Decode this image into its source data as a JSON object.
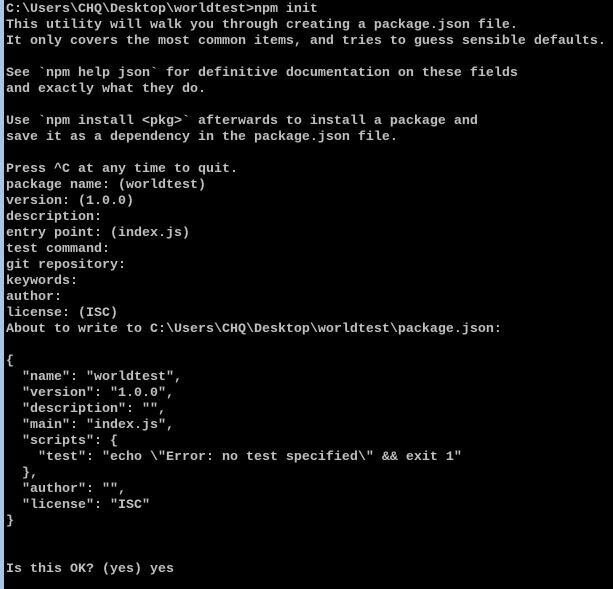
{
  "console": {
    "lines": [
      "C:\\Users\\CHQ\\Desktop\\worldtest>npm init",
      "This utility will walk you through creating a package.json file.",
      "It only covers the most common items, and tries to guess sensible defaults.",
      "",
      "See `npm help json` for definitive documentation on these fields",
      "and exactly what they do.",
      "",
      "Use `npm install <pkg>` afterwards to install a package and",
      "save it as a dependency in the package.json file.",
      "",
      "Press ^C at any time to quit.",
      "package name: (worldtest)",
      "version: (1.0.0)",
      "description:",
      "entry point: (index.js)",
      "test command:",
      "git repository:",
      "keywords:",
      "author:",
      "license: (ISC)",
      "About to write to C:\\Users\\CHQ\\Desktop\\worldtest\\package.json:",
      "",
      "{",
      "  \"name\": \"worldtest\",",
      "  \"version\": \"1.0.0\",",
      "  \"description\": \"\",",
      "  \"main\": \"index.js\",",
      "  \"scripts\": {",
      "    \"test\": \"echo \\\"Error: no test specified\\\" && exit 1\"",
      "  },",
      "  \"author\": \"\",",
      "  \"license\": \"ISC\"",
      "}",
      "",
      "",
      "Is this OK? (yes) yes"
    ]
  },
  "colors": {
    "background": "#000000",
    "text": "#c0c0c0",
    "window_border": "#a9c6e6"
  }
}
